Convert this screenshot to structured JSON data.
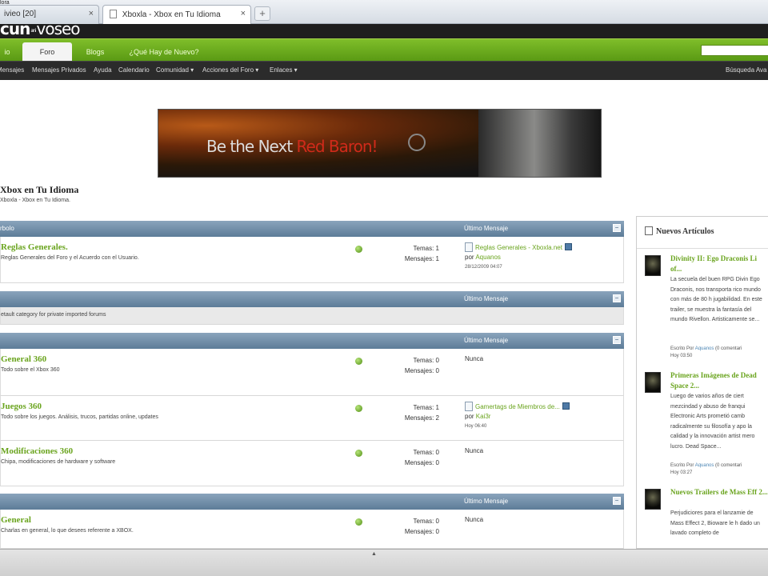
{
  "browser": {
    "corner_label": "lora",
    "tab1_label": "ivieo [20]",
    "tab2_label": "Xboxla - Xbox en Tu Idioma",
    "close_glyph": "×",
    "new_tab_glyph": "+"
  },
  "site": {
    "logo_main": "cun",
    "logo_small": "ani",
    "logo_tail": "voseo",
    "green_tabs": [
      "io",
      "Foro",
      "Blogs",
      "¿Qué Hay de Nuevo?"
    ],
    "dark_nav": [
      "Mensajes",
      "Mensajes Privados",
      "Ayuda",
      "Calendario",
      "Comunidad ▾",
      "Acciones del Foro ▾",
      "Enlaces ▾",
      "Búsqueda Ava"
    ],
    "banner_white": "Be the Next ",
    "banner_red": "Red Baron!",
    "forum_title": "Xbox en Tu Idioma",
    "forum_breadcrumb": "Xboxla - Xbox en Tu Idioma."
  },
  "forum": {
    "ultimo_label": "Último Mensaje",
    "collapse_glyph": "−",
    "cat1_label": "rbolo",
    "cat2_desc": "etault category for private imported forums",
    "rows": [
      {
        "title": "Reglas Generales.",
        "desc": "Reglas Generales del Foro y el Acuerdo con el Usuario.",
        "temas": "Temas: 1",
        "mensajes": "Mensajes: 1",
        "last_title": "Reglas Generales - Xboxla.net",
        "last_by": "por",
        "last_user": "Aquanos",
        "last_date": "28/12/2009 04:07"
      },
      {
        "title": "General 360",
        "desc": "Todo sobre el Xbox 360",
        "temas": "Temas: 0",
        "mensajes": "Mensajes: 0",
        "last_none": "Nunca"
      },
      {
        "title": "Juegos 360",
        "desc": "Todo sobre los juegos. Análisis, trucos, partidas online, updates",
        "temas": "Temas: 1",
        "mensajes": "Mensajes: 2",
        "last_title": "Gamertags de Miembros de...",
        "last_by": "por",
        "last_user": "Kai3r",
        "last_date": "Hoy 06:40"
      },
      {
        "title": "Modificaciones 360",
        "desc": "Chipa, modificaciones de hardware y software",
        "temas": "Temas: 0",
        "mensajes": "Mensajes: 0",
        "last_none": "Nunca"
      },
      {
        "title": "General",
        "desc": "Charlas en general, lo que desees referente a XBOX.",
        "temas": "Temas: 0",
        "mensajes": "Mensajes: 0",
        "last_none": "Nunca"
      }
    ]
  },
  "sidebar": {
    "heading": "Nuevos Artículos",
    "articles": [
      {
        "title": "Divinity II: Ego Draconis Li of...",
        "body": "La secuela del buen RPG Divin Ego Draconis, nos transporta rico mundo con más de 80 h jugabilidad. En este trailer, se muestra la fantasía del mundo Rivellon. Artisticamente se...",
        "meta_prefix": "Escrito Por",
        "meta_user": "Aquanos",
        "meta_suffix": " (0 comentari",
        "meta_date": "Hoy 03:50"
      },
      {
        "title": "Primeras Imágenes de Dead Space 2...",
        "body": "Luego de varios años de ciert mezcindad y abuso de franqui Electronic Arts prometió camb radicalmente su filosofía y apo la calidad y la innovación artist mero lucro. Dead Space...",
        "meta_prefix": "Escrito Por",
        "meta_user": "Aquanos",
        "meta_suffix": " (0 comentari",
        "meta_date": "Hoy 03:27"
      },
      {
        "title": "Nuevos Trailers de Mass Eff 2...",
        "body": "Perjudiciores para el lanzamie de Mass Effect 2, Bioware le h dado un lavado completo de",
        "meta_prefix": "",
        "meta_user": "",
        "meta_suffix": "",
        "meta_date": ""
      }
    ]
  },
  "statusbar": {
    "grip": "▲"
  }
}
